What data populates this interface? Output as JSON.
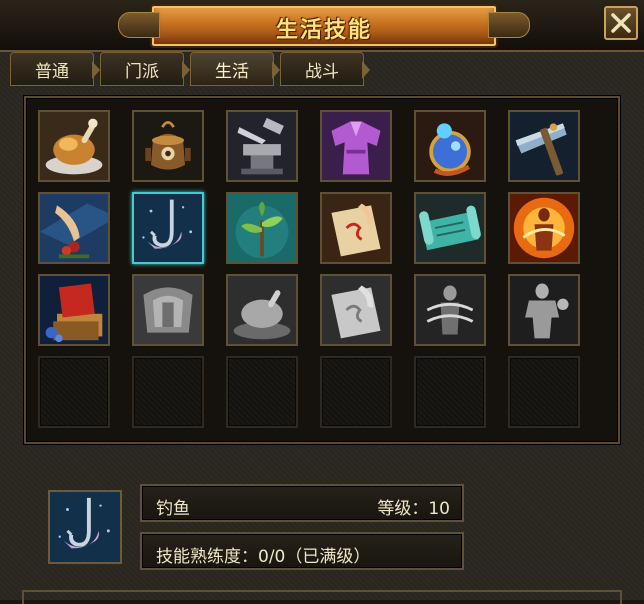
{
  "window": {
    "title": "生活技能"
  },
  "tabs": [
    {
      "label": "普通",
      "active": false
    },
    {
      "label": "门派",
      "active": false
    },
    {
      "label": "生活",
      "active": true
    },
    {
      "label": "战斗",
      "active": false
    }
  ],
  "skills": [
    {
      "icon": "roast-chicken-icon",
      "state": "available"
    },
    {
      "icon": "alchemy-cauldron-icon",
      "state": "available"
    },
    {
      "icon": "anvil-forging-icon",
      "state": "available"
    },
    {
      "icon": "tailoring-robe-icon",
      "state": "available"
    },
    {
      "icon": "jewelry-craft-icon",
      "state": "available"
    },
    {
      "icon": "mining-hammer-icon",
      "state": "available"
    },
    {
      "icon": "herb-gathering-icon",
      "state": "available"
    },
    {
      "icon": "fishing-hook-icon",
      "state": "selected"
    },
    {
      "icon": "sprout-planting-icon",
      "state": "available"
    },
    {
      "icon": "talisman-scroll-icon",
      "state": "available"
    },
    {
      "icon": "teal-scroll-icon",
      "state": "available"
    },
    {
      "icon": "fire-body-icon",
      "state": "available"
    },
    {
      "icon": "book-study-icon",
      "state": "available"
    },
    {
      "icon": "shield-grey-icon",
      "state": "locked"
    },
    {
      "icon": "chicken-grey-icon",
      "state": "locked"
    },
    {
      "icon": "scroll-grey-icon",
      "state": "locked"
    },
    {
      "icon": "spiral-grey-icon",
      "state": "locked"
    },
    {
      "icon": "muscle-grey-icon",
      "state": "locked"
    }
  ],
  "detail": {
    "icon": "fishing-hook-icon",
    "skill_name": "钓鱼",
    "level_text": "等级：10",
    "proficiency_text": "技能熟练度：0/0（已满级）"
  },
  "colors": {
    "selected_border": "#44cbd0",
    "title_text": "#ffe27a"
  }
}
